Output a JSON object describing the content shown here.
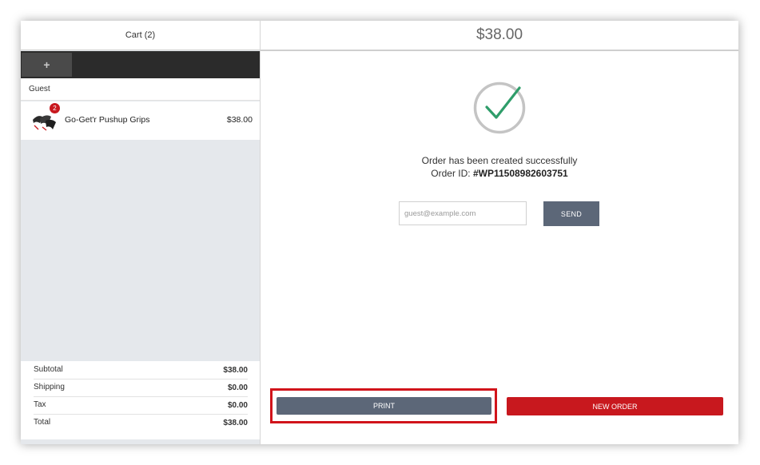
{
  "cart": {
    "title": "Cart (2)",
    "add_tab_label": "+",
    "customer": "Guest",
    "items": [
      {
        "name": "Go-Get'r Pushup Grips",
        "price": "$38.00",
        "qty": "2",
        "icon": "pushup-grips-thumbnail"
      }
    ],
    "totals": [
      {
        "label": "Subtotal",
        "value": "$38.00"
      },
      {
        "label": "Shipping",
        "value": "$0.00"
      },
      {
        "label": "Tax",
        "value": "$0.00"
      },
      {
        "label": "Total",
        "value": "$38.00"
      }
    ]
  },
  "main": {
    "amount": "$38.00",
    "success_icon": "checkmark-circle-icon",
    "message": "Order has been created successfully",
    "order_id_label": "Order ID:",
    "order_id": "#WP11508982603751",
    "email_placeholder": "guest@example.com",
    "send_label": "SEND",
    "print_label": "PRINT",
    "new_order_label": "NEW ORDER"
  },
  "colors": {
    "accent_red": "#c8181e",
    "button_slate": "#5c6778",
    "check_green": "#2f9d6a",
    "highlight_red": "#d1141b"
  }
}
